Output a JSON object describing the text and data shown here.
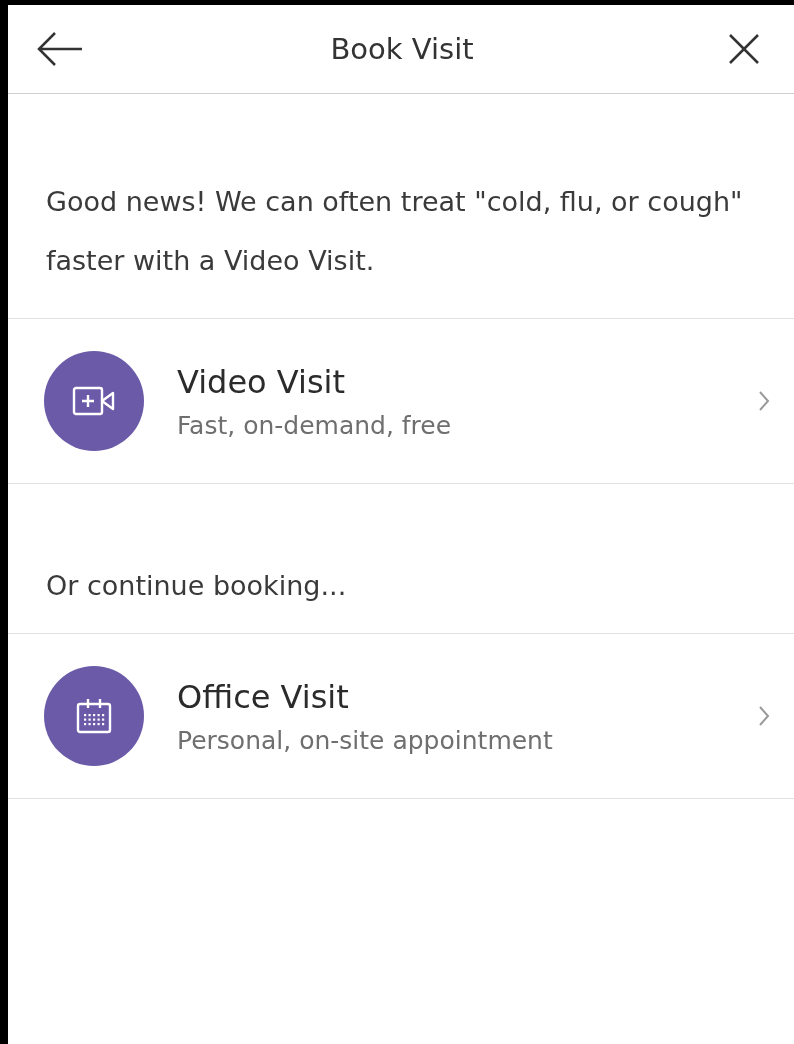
{
  "header": {
    "title": "Book Visit"
  },
  "intro": "Good news! We can often treat \"cold, flu, or cough\" faster with a Video Visit.",
  "primary_options": [
    {
      "kind": "video",
      "title": "Video Visit",
      "subtitle": "Fast, on-demand, free"
    }
  ],
  "section_label": "Or continue booking...",
  "secondary_options": [
    {
      "kind": "office",
      "title": "Office Visit",
      "subtitle": "Personal, on-site appointment"
    }
  ]
}
